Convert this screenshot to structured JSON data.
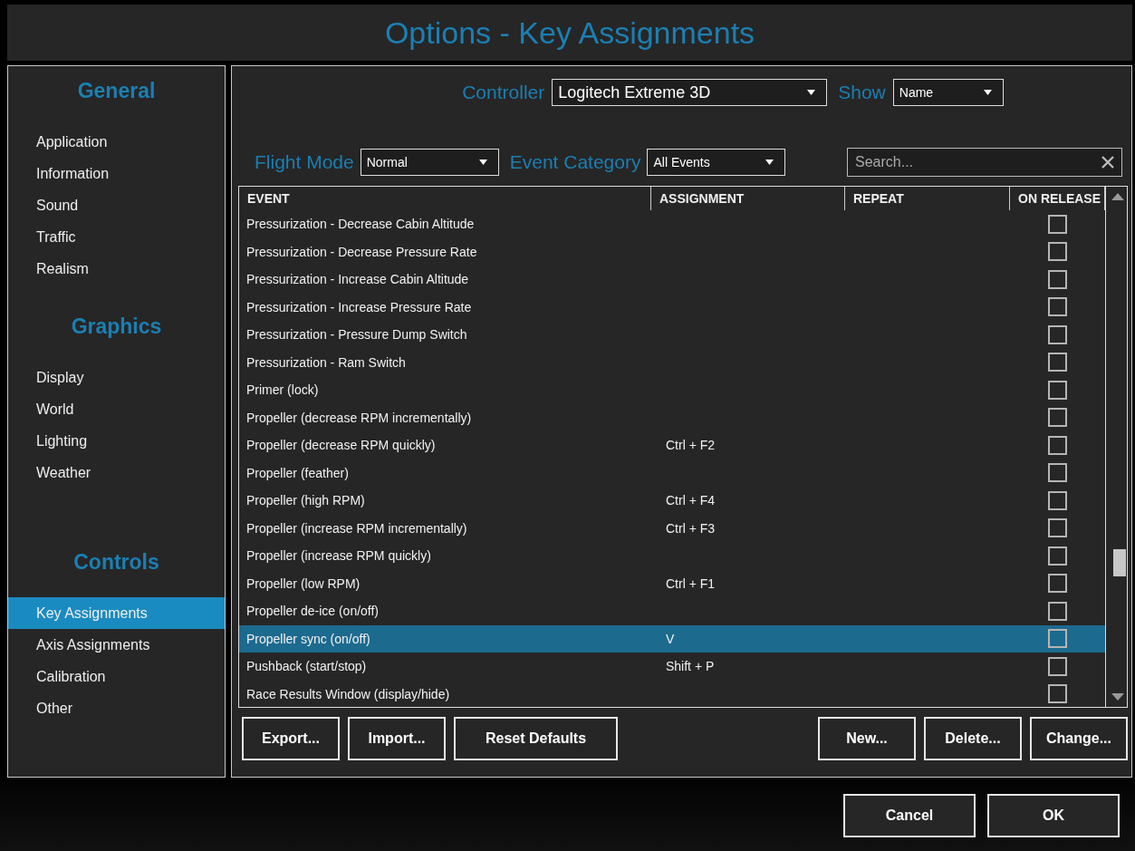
{
  "window": {
    "title": "Options - Key Assignments"
  },
  "sidebar": {
    "sections": [
      {
        "title": "General",
        "items": [
          {
            "label": "Application",
            "selected": false
          },
          {
            "label": "Information",
            "selected": false
          },
          {
            "label": "Sound",
            "selected": false
          },
          {
            "label": "Traffic",
            "selected": false
          },
          {
            "label": "Realism",
            "selected": false
          }
        ]
      },
      {
        "title": "Graphics",
        "items": [
          {
            "label": "Display",
            "selected": false
          },
          {
            "label": "World",
            "selected": false
          },
          {
            "label": "Lighting",
            "selected": false
          },
          {
            "label": "Weather",
            "selected": false
          }
        ]
      },
      {
        "title": "Controls",
        "items": [
          {
            "label": "Key Assignments",
            "selected": true
          },
          {
            "label": "Axis Assignments",
            "selected": false
          },
          {
            "label": "Calibration",
            "selected": false
          },
          {
            "label": "Other",
            "selected": false
          }
        ]
      }
    ]
  },
  "controller": {
    "label": "Controller",
    "value": "Logitech Extreme 3D"
  },
  "show": {
    "label": "Show",
    "value": "Name"
  },
  "flight_mode": {
    "label": "Flight Mode",
    "value": "Normal"
  },
  "event_category": {
    "label": "Event Category",
    "value": "All Events"
  },
  "search": {
    "placeholder": "Search..."
  },
  "table": {
    "columns": [
      "EVENT",
      "ASSIGNMENT",
      "REPEAT",
      "ON RELEASE"
    ],
    "rows": [
      {
        "event": "Pressurization - Decrease Cabin Altitude",
        "assignment": "",
        "on_release": false,
        "selected": false
      },
      {
        "event": "Pressurization - Decrease Pressure Rate",
        "assignment": "",
        "on_release": false,
        "selected": false
      },
      {
        "event": "Pressurization - Increase Cabin Altitude",
        "assignment": "",
        "on_release": false,
        "selected": false
      },
      {
        "event": "Pressurization - Increase Pressure Rate",
        "assignment": "",
        "on_release": false,
        "selected": false
      },
      {
        "event": "Pressurization - Pressure Dump Switch",
        "assignment": "",
        "on_release": false,
        "selected": false
      },
      {
        "event": "Pressurization - Ram Switch",
        "assignment": "",
        "on_release": false,
        "selected": false
      },
      {
        "event": "Primer (lock)",
        "assignment": "",
        "on_release": false,
        "selected": false
      },
      {
        "event": "Propeller (decrease RPM incrementally)",
        "assignment": "",
        "on_release": false,
        "selected": false
      },
      {
        "event": "Propeller (decrease RPM quickly)",
        "assignment": "Ctrl + F2",
        "on_release": false,
        "selected": false
      },
      {
        "event": "Propeller (feather)",
        "assignment": "",
        "on_release": false,
        "selected": false
      },
      {
        "event": "Propeller (high RPM)",
        "assignment": "Ctrl + F4",
        "on_release": false,
        "selected": false
      },
      {
        "event": "Propeller (increase RPM incrementally)",
        "assignment": "Ctrl + F3",
        "on_release": false,
        "selected": false
      },
      {
        "event": "Propeller (increase RPM quickly)",
        "assignment": "",
        "on_release": false,
        "selected": false
      },
      {
        "event": "Propeller (low RPM)",
        "assignment": "Ctrl + F1",
        "on_release": false,
        "selected": false
      },
      {
        "event": "Propeller de-ice (on/off)",
        "assignment": "",
        "on_release": false,
        "selected": false
      },
      {
        "event": "Propeller sync (on/off)",
        "assignment": "V",
        "on_release": false,
        "selected": true
      },
      {
        "event": "Pushback (start/stop)",
        "assignment": "Shift + P",
        "on_release": false,
        "selected": false
      },
      {
        "event": "Race Results Window (display/hide)",
        "assignment": "",
        "on_release": false,
        "selected": false
      }
    ]
  },
  "list_buttons_left": [
    "Export...",
    "Import...",
    "Reset Defaults"
  ],
  "list_buttons_right": [
    "New...",
    "Delete...",
    "Change..."
  ],
  "dialog_buttons": [
    "Cancel",
    "OK"
  ]
}
